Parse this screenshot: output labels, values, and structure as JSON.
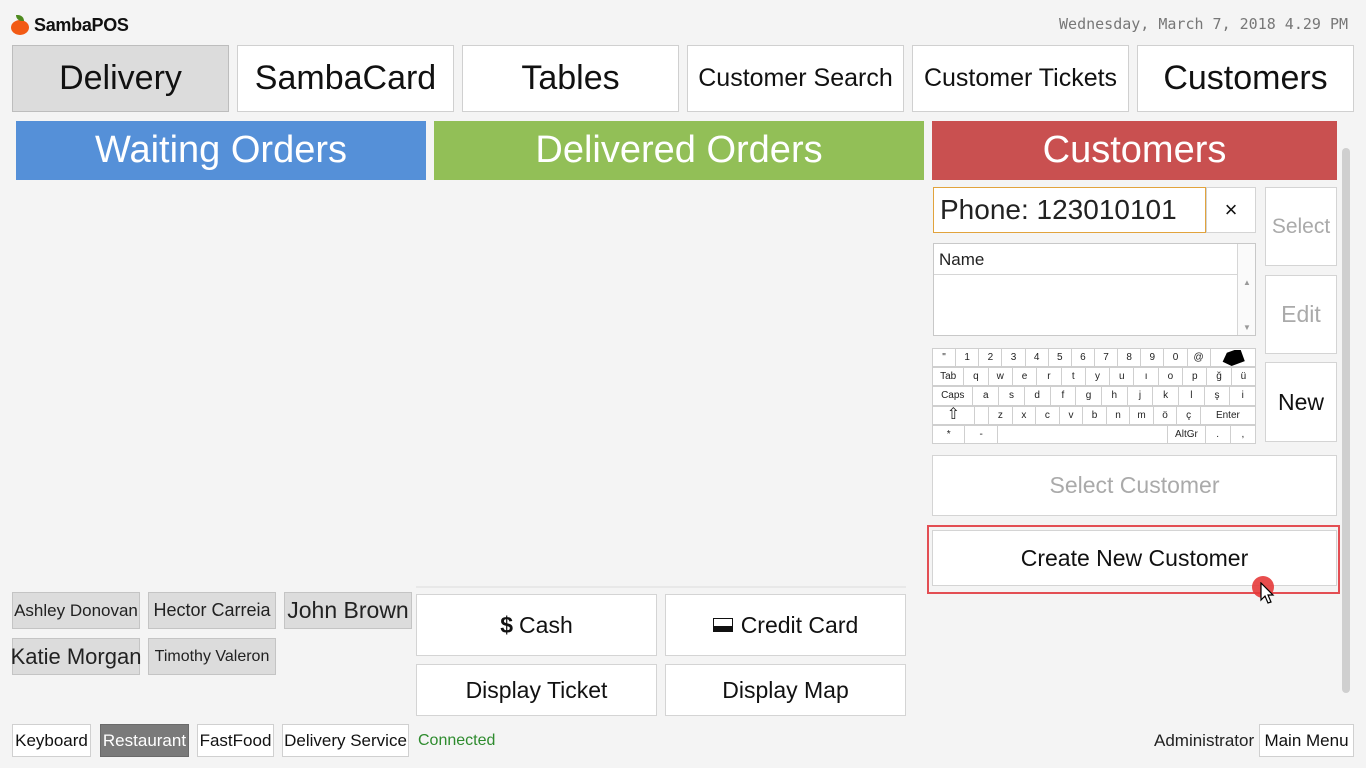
{
  "app": {
    "name": "SambaPOS",
    "datetime": "Wednesday, March 7, 2018 4.29 PM"
  },
  "tabs": [
    "Delivery",
    "SambaCard",
    "Tables",
    "Customer Search",
    "Customer Tickets",
    "Customers"
  ],
  "headers": {
    "waiting": "Waiting Orders",
    "delivered": "Delivered Orders",
    "customers": "Customers"
  },
  "customer_panel": {
    "phone_value": "Phone: 123010101",
    "clear_symbol": "×",
    "name_column": "Name",
    "side_buttons": {
      "select": "Select",
      "edit": "Edit",
      "new": "New"
    },
    "select_customer": "Select Customer",
    "create_new_customer": "Create New Customer"
  },
  "keyboard": {
    "row1": [
      "\"",
      "1",
      "2",
      "3",
      "4",
      "5",
      "6",
      "7",
      "8",
      "9",
      "0",
      "@"
    ],
    "row2": [
      "Tab",
      "q",
      "w",
      "e",
      "r",
      "t",
      "y",
      "u",
      "ı",
      "o",
      "p",
      "ğ",
      "ü"
    ],
    "row3": [
      "Caps",
      "a",
      "s",
      "d",
      "f",
      "g",
      "h",
      "j",
      "k",
      "l",
      "ş",
      "i"
    ],
    "row4": [
      "z",
      "x",
      "c",
      "v",
      "b",
      "n",
      "m",
      "ö",
      "ç",
      "Enter"
    ],
    "row5": [
      "*",
      "-",
      "AltGr",
      ".",
      ","
    ]
  },
  "customer_chips": [
    "Ashley Donovan",
    "Hector Carreia",
    "John Brown",
    "Katie Morgan",
    "Timothy Valeron"
  ],
  "actions": {
    "cash": "Cash",
    "cash_symbol": "$",
    "credit_card": "Credit Card",
    "display_ticket": "Display Ticket",
    "display_map": "Display Map"
  },
  "bottom_bar": {
    "keyboard": "Keyboard",
    "restaurant": "Restaurant",
    "fastfood": "FastFood",
    "delivery_service": "Delivery Service",
    "status": "Connected",
    "user": "Administrator",
    "main_menu": "Main Menu"
  },
  "colors": {
    "waiting_orders": "#5590d8",
    "delivered_orders": "#92bf57",
    "customers": "#c95050",
    "status_connected": "#2e8b2e",
    "highlight": "#e34e53"
  }
}
